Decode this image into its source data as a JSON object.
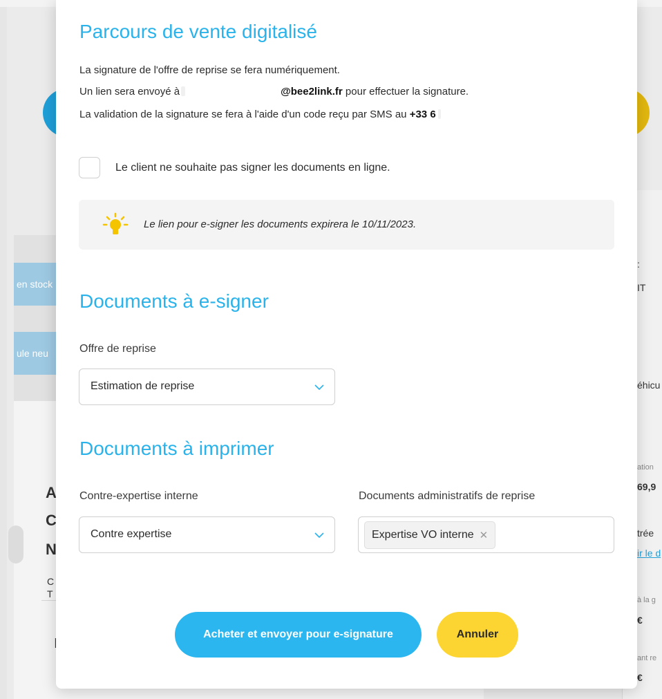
{
  "background": {
    "chip_1": "en stock",
    "chip_2": "ule neu",
    "right_texts": [
      ": ",
      "IT",
      "éhicu",
      "ation",
      "69,9",
      "trée",
      "ir le d",
      "à la g",
      "€",
      "ant re",
      "€"
    ],
    "left_letters": [
      "A",
      "C",
      "N"
    ],
    "left_small": [
      "C",
      "T",
      "I"
    ]
  },
  "modal": {
    "section_sale": {
      "title": "Parcours de vente digitalisé",
      "line1": "La signature de l'offre de reprise se fera numériquement.",
      "line2_prefix": "Un lien sera envoyé à",
      "line2_email": "@bee2link.fr",
      "line2_suffix": " pour effectuer la signature.",
      "line3_prefix": "La validation de la signature se fera à l'aide d'un code reçu par SMS au ",
      "line3_phone": "+33 6"
    },
    "checkbox": {
      "label": "Le client ne souhaite pas signer les documents en ligne.",
      "checked": false
    },
    "info": {
      "icon": "lightbulb-icon",
      "text": "Le lien pour e-signer les documents expirera le 10/11/2023."
    },
    "section_esign": {
      "title": "Documents à e-signer",
      "offer_label": "Offre de reprise",
      "offer_value": "Estimation de reprise"
    },
    "section_print": {
      "title": "Documents à imprimer",
      "counter_label": "Contre-expertise interne",
      "counter_value": "Contre expertise",
      "admin_label": "Documents administratifs de reprise",
      "admin_tags": [
        "Expertise VO interne"
      ]
    },
    "buttons": {
      "submit": "Acheter et envoyer pour e-signature",
      "cancel": "Annuler"
    }
  },
  "colors": {
    "accent_blue": "#2bb6ef",
    "title_blue": "#2ab3ea",
    "accent_yellow": "#fcd532"
  }
}
